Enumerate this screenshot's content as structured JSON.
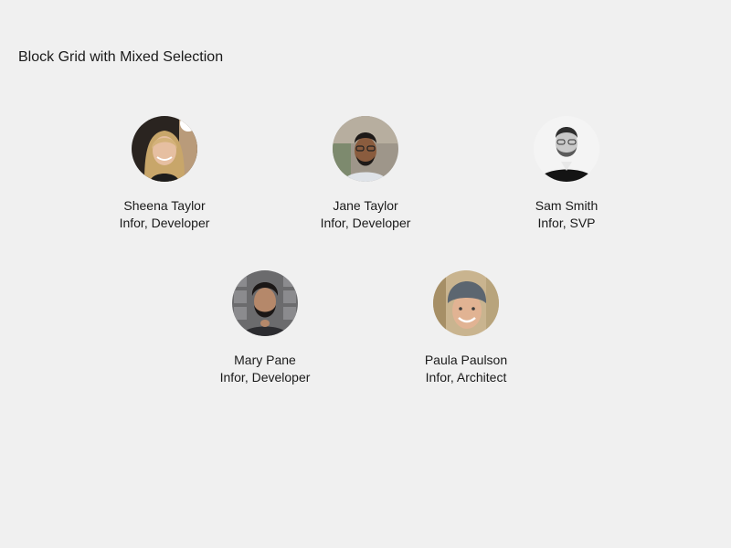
{
  "page": {
    "title": "Block Grid with Mixed Selection"
  },
  "blocks": [
    {
      "name": "Sheena Taylor",
      "role": "Infor, Developer"
    },
    {
      "name": "Jane Taylor",
      "role": "Infor, Developer"
    },
    {
      "name": "Sam Smith",
      "role": "Infor, SVP"
    },
    {
      "name": "Mary Pane",
      "role": "Infor, Developer"
    },
    {
      "name": "Paula Paulson",
      "role": "Infor, Architect"
    }
  ],
  "colors": {
    "background": "#f0f0f0",
    "text": "#1a1a1a"
  }
}
